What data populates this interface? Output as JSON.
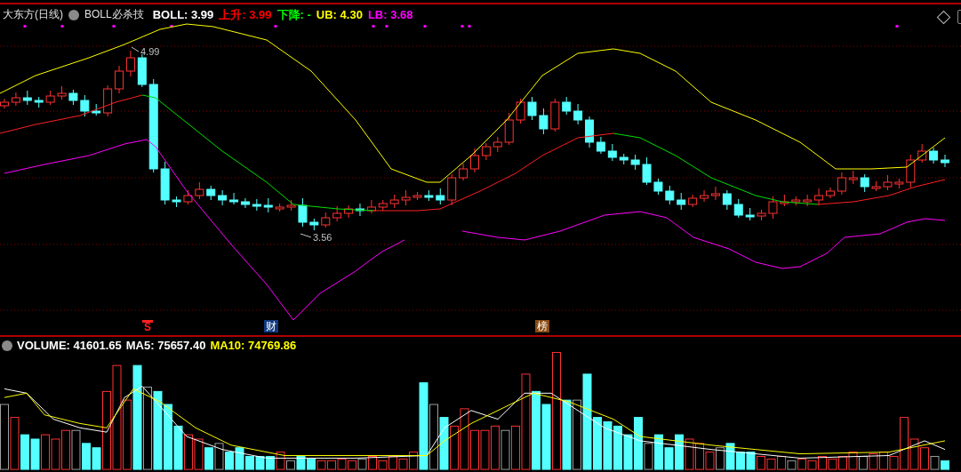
{
  "main_panel": {
    "title": "大东方(日线)",
    "indicator": "BOLL必杀技",
    "readings": [
      {
        "text": "BOLL: 3.99",
        "color": "#ffffff"
      },
      {
        "text": "上升: 3.99",
        "color": "#ff0000"
      },
      {
        "text": "下降: -",
        "color": "#00ff00"
      },
      {
        "text": "UB: 4.30",
        "color": "#ffff00"
      },
      {
        "text": "LB: 3.68",
        "color": "#ff00ff"
      }
    ],
    "price_labels": [
      {
        "text": "4.99",
        "kind": "high"
      },
      {
        "text": "3.56",
        "kind": "low"
      }
    ],
    "event_markers": [
      {
        "text": "S",
        "kind": "signal"
      },
      {
        "text": "财",
        "kind": "finance"
      },
      {
        "text": "榜",
        "kind": "ranking"
      }
    ]
  },
  "volume_panel": {
    "readings": [
      {
        "text": "VOLUME: 41601.65",
        "color": "#ffffff"
      },
      {
        "text": "MA5: 75657.40",
        "color": "#ffffff"
      },
      {
        "text": "MA10: 74769.86",
        "color": "#ffff00"
      }
    ]
  }
}
